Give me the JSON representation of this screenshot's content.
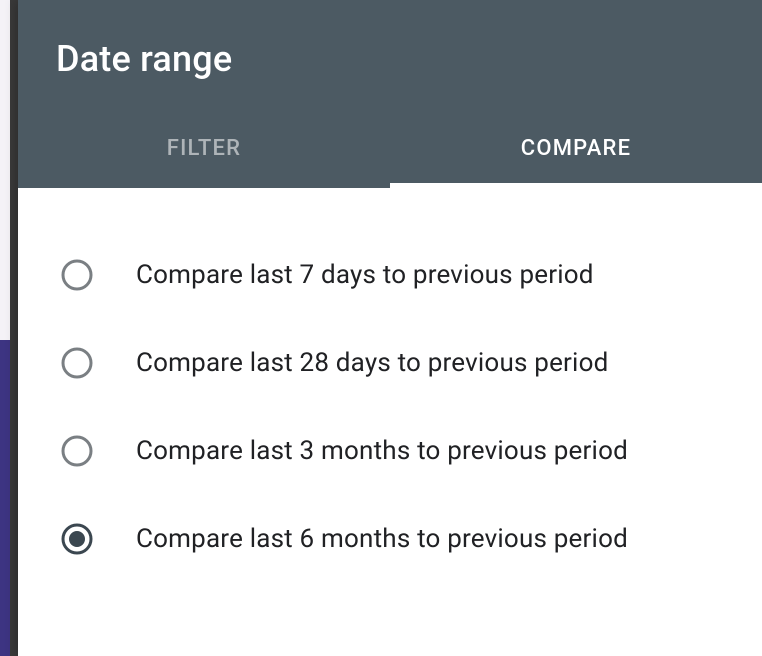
{
  "header": {
    "title": "Date range"
  },
  "tabs": {
    "filter": {
      "label": "FILTER",
      "active": false
    },
    "compare": {
      "label": "COMPARE",
      "active": true
    }
  },
  "options": [
    {
      "label": "Compare last 7 days to previous period",
      "selected": false
    },
    {
      "label": "Compare last 28 days to previous period",
      "selected": false
    },
    {
      "label": "Compare last 3 months to previous period",
      "selected": false
    },
    {
      "label": "Compare last 6 months to previous period",
      "selected": true
    }
  ]
}
